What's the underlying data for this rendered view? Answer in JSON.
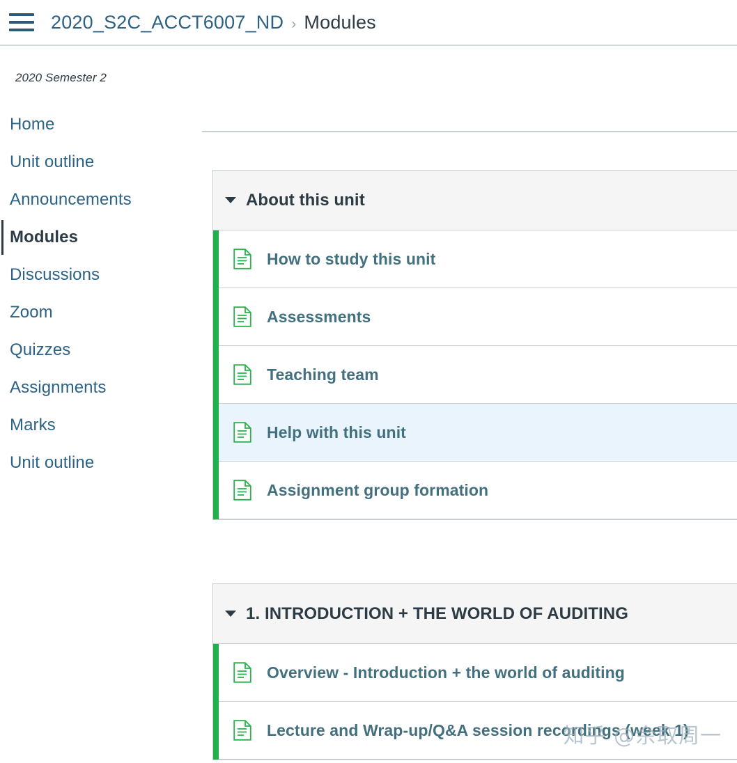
{
  "header": {
    "menu_icon": "hamburger-menu-icon",
    "breadcrumb": {
      "course": "2020_S2C_ACCT6007_ND",
      "separator": "›",
      "current": "Modules"
    }
  },
  "sidebar": {
    "term_label": "2020 Semester 2",
    "items": [
      {
        "label": "Home",
        "active": false
      },
      {
        "label": "Unit outline",
        "active": false
      },
      {
        "label": "Announcements",
        "active": false
      },
      {
        "label": "Modules",
        "active": true
      },
      {
        "label": "Discussions",
        "active": false
      },
      {
        "label": "Zoom",
        "active": false
      },
      {
        "label": "Quizzes",
        "active": false
      },
      {
        "label": "Assignments",
        "active": false
      },
      {
        "label": "Marks",
        "active": false
      },
      {
        "label": "Unit outline",
        "active": false
      }
    ]
  },
  "main": {
    "modules": [
      {
        "title": "About this unit",
        "collapse_icon": "caret-down-icon",
        "items": [
          {
            "label": "How to study this unit",
            "icon": "document-icon",
            "highlighted": false
          },
          {
            "label": "Assessments",
            "icon": "document-icon",
            "highlighted": false
          },
          {
            "label": "Teaching team",
            "icon": "document-icon",
            "highlighted": false
          },
          {
            "label": "Help with this unit",
            "icon": "document-icon",
            "highlighted": true
          },
          {
            "label": "Assignment group formation",
            "icon": "document-icon",
            "highlighted": false
          }
        ]
      },
      {
        "title": "1. INTRODUCTION + THE WORLD OF AUDITING",
        "collapse_icon": "caret-down-icon",
        "items": [
          {
            "label": "Overview - Introduction + the world of auditing",
            "icon": "document-icon",
            "highlighted": false
          },
          {
            "label": "Lecture and Wrap-up/Q&A session recordings (week 1)",
            "icon": "document-icon",
            "highlighted": false
          }
        ]
      }
    ]
  },
  "watermark": {
    "text": "知乎 @佘取周一"
  },
  "colors": {
    "link_blue": "#2b6285",
    "text_dark": "#2d3b45",
    "module_green": "#1eb14d",
    "row_highlight": "#eaf4fc",
    "header_gray": "#f5f5f5",
    "border_gray": "#c7cdd1",
    "item_label": "#43707f"
  }
}
